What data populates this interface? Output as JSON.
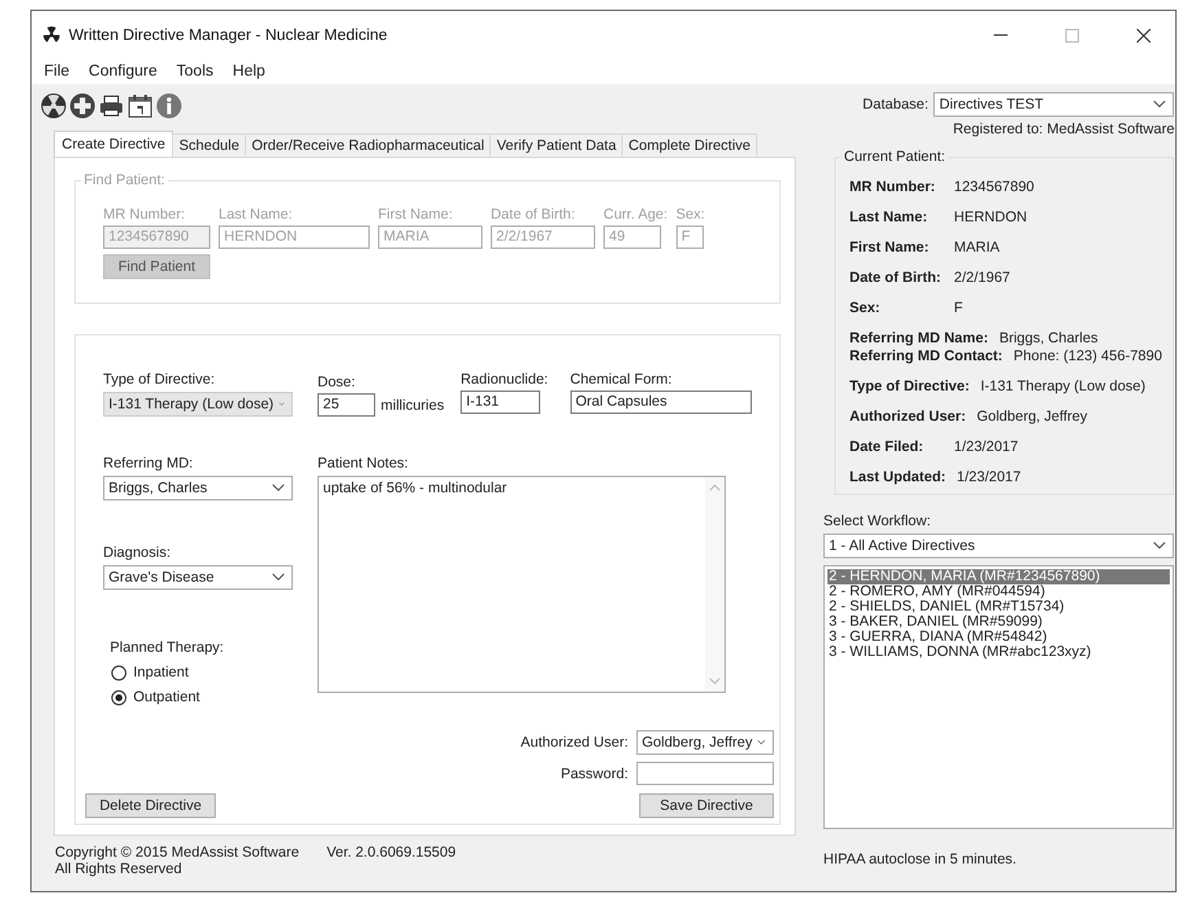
{
  "window": {
    "title": "Written Directive Manager - Nuclear Medicine"
  },
  "menu": [
    "File",
    "Configure",
    "Tools",
    "Help"
  ],
  "database": {
    "label": "Database:",
    "value": "Directives TEST"
  },
  "registered": "Registered to: MedAssist Software",
  "tabs": [
    {
      "label": "Create Directive",
      "selected": true
    },
    {
      "label": "Schedule",
      "selected": false
    },
    {
      "label": "Order/Receive Radiopharmaceutical",
      "selected": false
    },
    {
      "label": "Verify Patient Data",
      "selected": false
    },
    {
      "label": "Complete Directive",
      "selected": false
    }
  ],
  "find_patient": {
    "title": "Find Patient:",
    "disabled": true,
    "fields": [
      {
        "label": "MR Number:",
        "value": "1234567890",
        "readonly": true
      },
      {
        "label": "Last Name:",
        "value": "HERNDON",
        "readonly": false
      },
      {
        "label": "First Name:",
        "value": "MARIA",
        "readonly": false
      },
      {
        "label": "Date of Birth:",
        "value": "2/2/1967",
        "readonly": false
      },
      {
        "label": "Curr. Age:",
        "value": "49",
        "readonly": false
      },
      {
        "label": "Sex:",
        "value": "F",
        "readonly": false
      }
    ],
    "button": "Find Patient"
  },
  "directive": {
    "type": {
      "label": "Type of Directive:",
      "value": "I-131 Therapy (Low dose)"
    },
    "dose": {
      "label": "Dose:",
      "value": "25",
      "unit": "millicuries"
    },
    "radionuclide": {
      "label": "Radionuclide:",
      "value": "I-131"
    },
    "chemical_form": {
      "label": "Chemical Form:",
      "value": "Oral Capsules"
    },
    "referring_md": {
      "label": "Referring MD:",
      "value": "Briggs, Charles"
    },
    "patient_notes": {
      "label": "Patient Notes:",
      "value": "uptake of 56% - multinodular"
    },
    "diagnosis": {
      "label": "Diagnosis:",
      "value": "Grave's Disease"
    },
    "planned_therapy": {
      "label": "Planned Therapy:",
      "options": [
        {
          "label": "Inpatient",
          "selected": false
        },
        {
          "label": "Outpatient",
          "selected": true
        }
      ]
    },
    "authorized_user": {
      "label": "Authorized User:",
      "value": "Goldberg, Jeffrey"
    },
    "password": {
      "label": "Password:"
    },
    "delete_button": "Delete Directive",
    "save_button": "Save Directive"
  },
  "footer": {
    "copyright": "Copyright © 2015 MedAssist Software",
    "rights": "All Rights Reserved",
    "version": "Ver. 2.0.6069.15509"
  },
  "current_patient": {
    "title": "Current Patient:",
    "blocks": [
      {
        "rows": [
          {
            "label": "MR Number:",
            "value": "1234567890"
          }
        ]
      },
      {
        "rows": [
          {
            "label": "Last Name:",
            "value": "HERNDON"
          }
        ]
      },
      {
        "rows": [
          {
            "label": "First Name:",
            "value": "MARIA"
          }
        ]
      },
      {
        "rows": [
          {
            "label": "Date of Birth:",
            "value": "2/2/1967"
          }
        ]
      },
      {
        "rows": [
          {
            "label": "Sex:",
            "value": "F"
          }
        ]
      },
      {
        "rows": [
          {
            "label": "Referring MD Name:",
            "value": "Briggs, Charles"
          },
          {
            "label": "Referring MD Contact:",
            "value": "Phone: (123) 456-7890"
          }
        ]
      },
      {
        "rows": [
          {
            "label": "Type of Directive:",
            "value": "I-131 Therapy (Low dose)"
          }
        ]
      },
      {
        "rows": [
          {
            "label": "Authorized User:",
            "value": "Goldberg, Jeffrey"
          }
        ]
      },
      {
        "rows": [
          {
            "label": "Date Filed:",
            "value": "1/23/2017"
          }
        ]
      },
      {
        "rows": [
          {
            "label": "Last Updated:",
            "value": "1/23/2017"
          }
        ]
      }
    ]
  },
  "workflow": {
    "label": "Select Workflow:",
    "value": "1 - All Active Directives",
    "items": [
      {
        "label": "2 - HERNDON, MARIA  (MR#1234567890)",
        "selected": true
      },
      {
        "label": "2 - ROMERO, AMY  (MR#044594)",
        "selected": false
      },
      {
        "label": "2 - SHIELDS, DANIEL  (MR#T15734)",
        "selected": false
      },
      {
        "label": "3 - BAKER, DANIEL  (MR#59099)",
        "selected": false
      },
      {
        "label": "3 - GUERRA, DIANA  (MR#54842)",
        "selected": false
      },
      {
        "label": "3 - WILLIAMS, DONNA  (MR#abc123xyz)",
        "selected": false
      }
    ]
  },
  "status": "HIPAA autoclose in 5 minutes."
}
